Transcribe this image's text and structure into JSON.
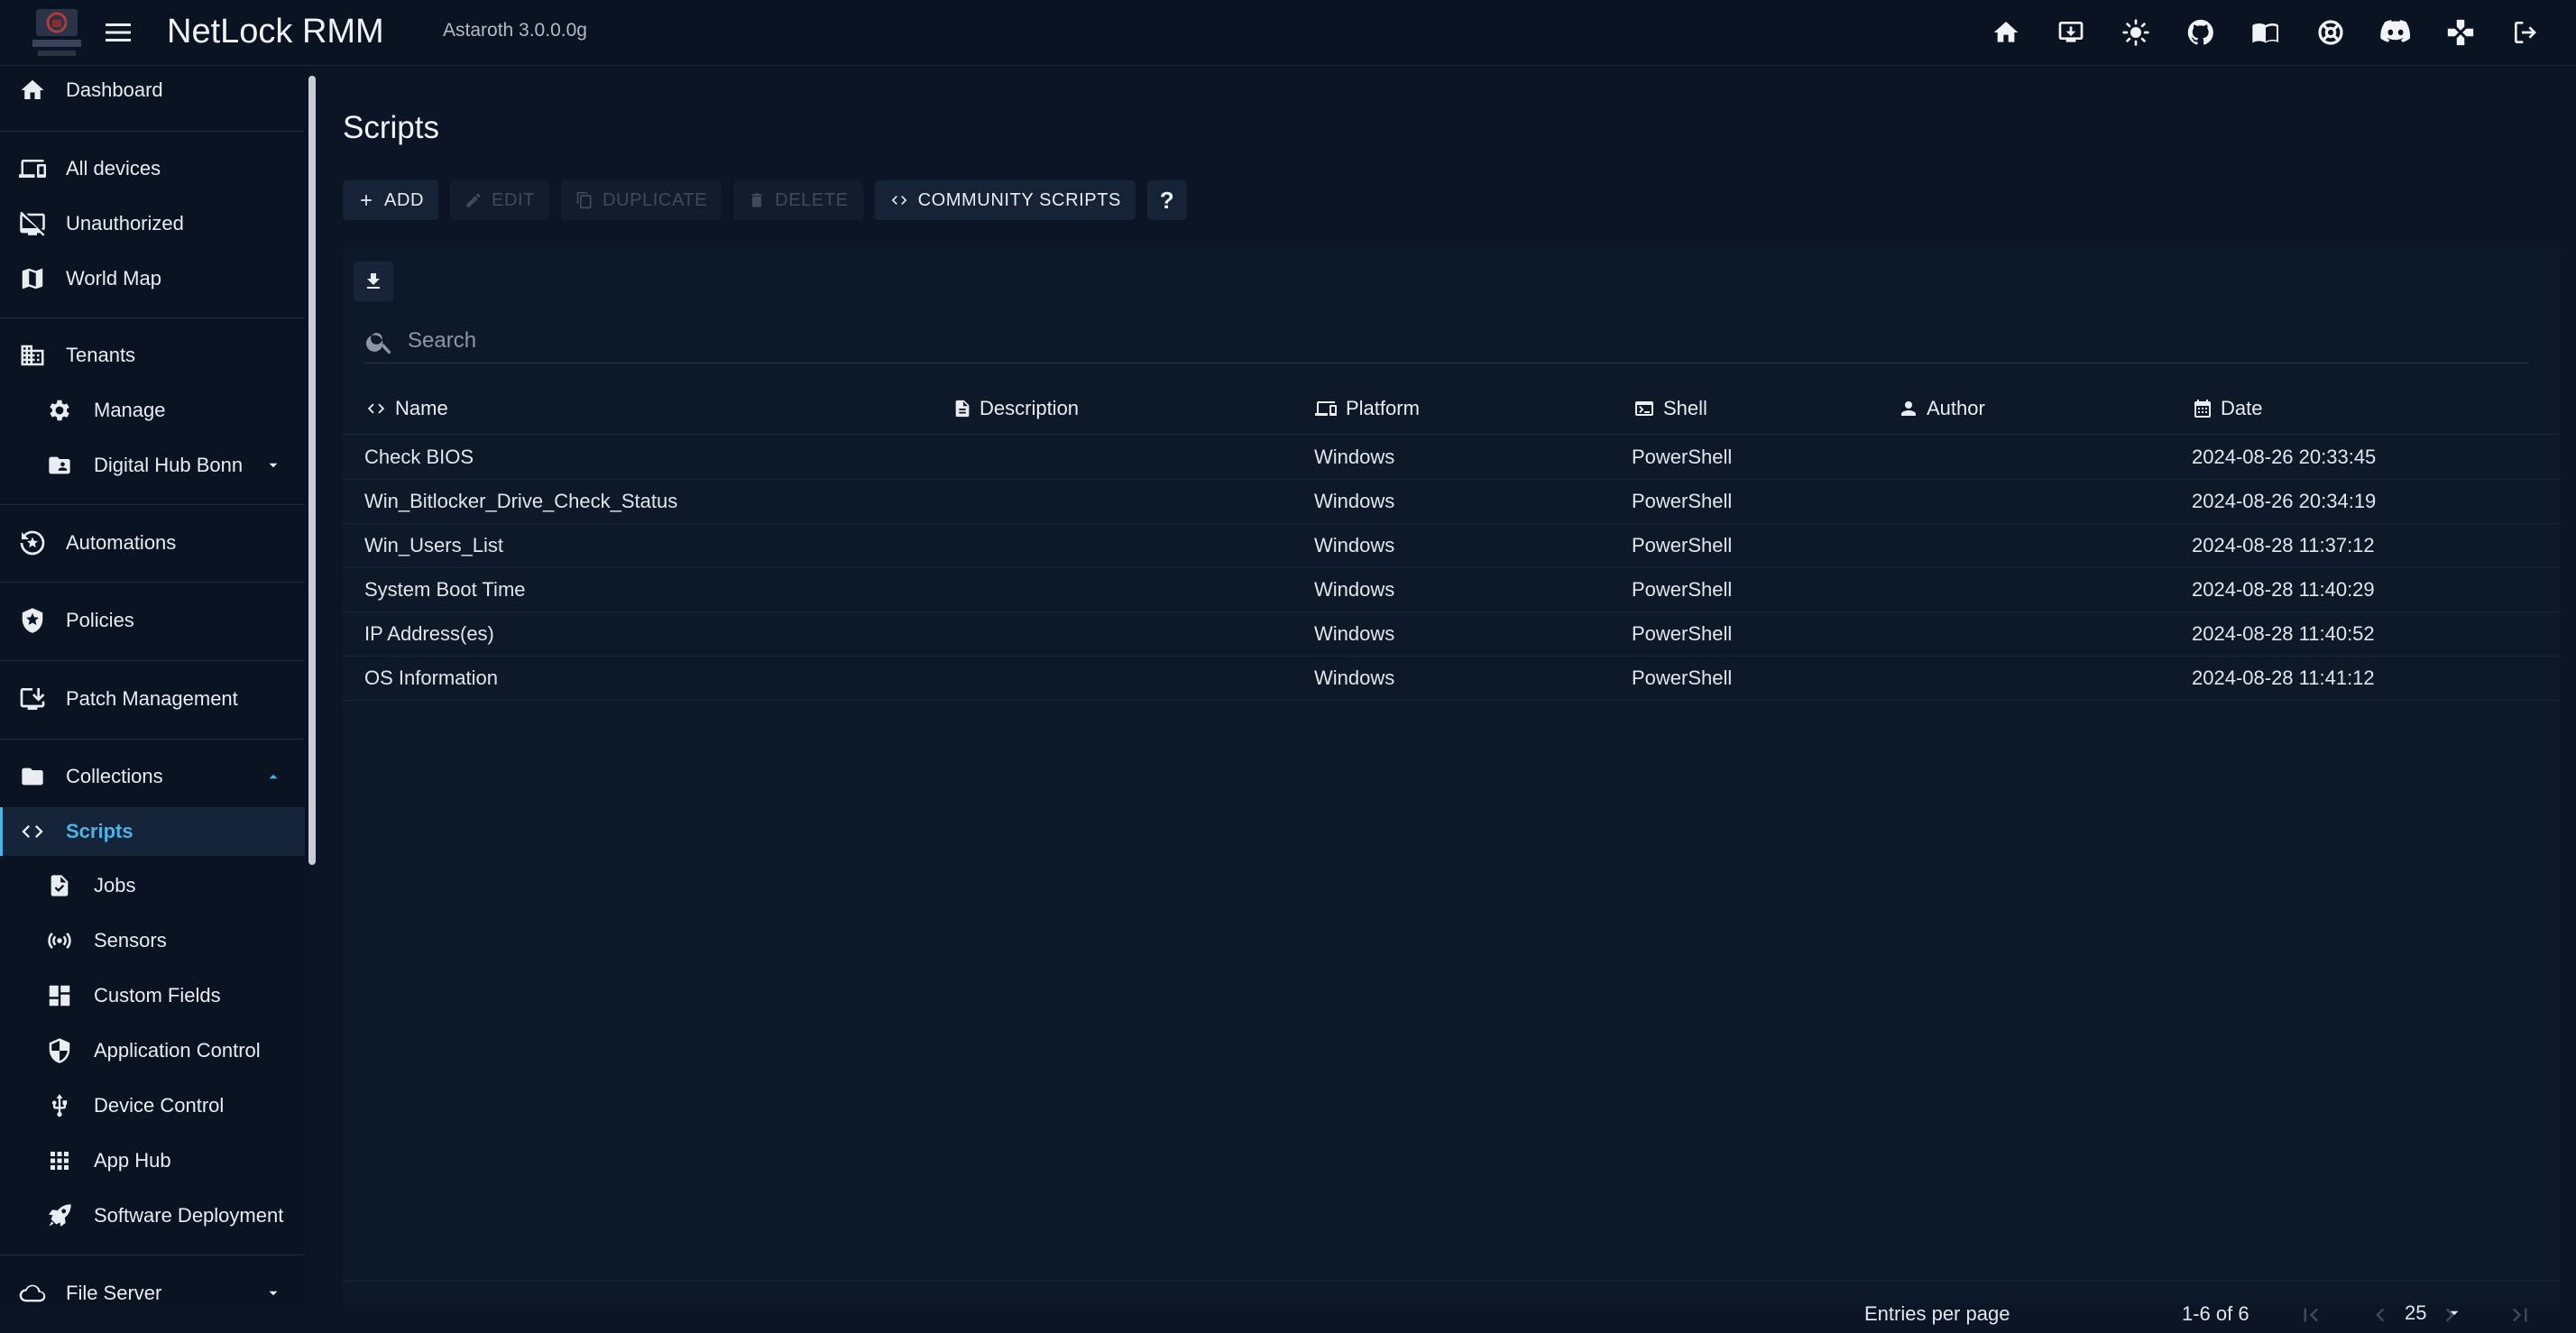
{
  "app": {
    "title": "NetLock RMM",
    "version": "Astaroth 3.0.0.0g",
    "logo_text": "NETLOCK RMM"
  },
  "topbar_icons": [
    "home-icon",
    "download-agent-icon",
    "theme-toggle-icon",
    "github-icon",
    "docs-icon",
    "support-icon",
    "discord-icon",
    "gamepad-icon",
    "logout-icon"
  ],
  "sidebar": {
    "dashboard": "Dashboard",
    "all_devices": "All devices",
    "unauthorized": "Unauthorized",
    "world_map": "World Map",
    "tenants": "Tenants",
    "manage": "Manage",
    "tenant_name": "Digital Hub Bonn",
    "automations": "Automations",
    "policies": "Policies",
    "patch_management": "Patch Management",
    "collections": "Collections",
    "scripts": "Scripts",
    "jobs": "Jobs",
    "sensors": "Sensors",
    "custom_fields": "Custom Fields",
    "application_control": "Application Control",
    "device_control": "Device Control",
    "app_hub": "App Hub",
    "software_deployment": "Software Deployment",
    "file_server": "File Server"
  },
  "page": {
    "title": "Scripts"
  },
  "toolbar": {
    "add": "ADD",
    "edit": "EDIT",
    "duplicate": "DUPLICATE",
    "delete": "DELETE",
    "community_scripts": "COMMUNITY SCRIPTS",
    "help": "?"
  },
  "search": {
    "placeholder": "Search",
    "value": ""
  },
  "table": {
    "headers": {
      "name": "Name",
      "description": "Description",
      "platform": "Platform",
      "shell": "Shell",
      "author": "Author",
      "date": "Date"
    },
    "rows": [
      {
        "name": "Check BIOS",
        "description": "",
        "platform": "Windows",
        "shell": "PowerShell",
        "author": "",
        "date": "2024-08-26 20:33:45"
      },
      {
        "name": "Win_Bitlocker_Drive_Check_Status",
        "description": "",
        "platform": "Windows",
        "shell": "PowerShell",
        "author": "",
        "date": "2024-08-26 20:34:19"
      },
      {
        "name": "Win_Users_List",
        "description": "",
        "platform": "Windows",
        "shell": "PowerShell",
        "author": "",
        "date": "2024-08-28 11:37:12"
      },
      {
        "name": "System Boot Time",
        "description": "",
        "platform": "Windows",
        "shell": "PowerShell",
        "author": "",
        "date": "2024-08-28 11:40:29"
      },
      {
        "name": "IP Address(es)",
        "description": "",
        "platform": "Windows",
        "shell": "PowerShell",
        "author": "",
        "date": "2024-08-28 11:40:52"
      },
      {
        "name": "OS Information",
        "description": "",
        "platform": "Windows",
        "shell": "PowerShell",
        "author": "",
        "date": "2024-08-28 11:41:12"
      }
    ]
  },
  "pagination": {
    "entries_label": "Entries per page",
    "per_page": "25",
    "range": "1-6 of 6"
  },
  "colors": {
    "background": "#0b1526",
    "sidebar": "#0a1322",
    "accent": "#4fb2e5"
  }
}
